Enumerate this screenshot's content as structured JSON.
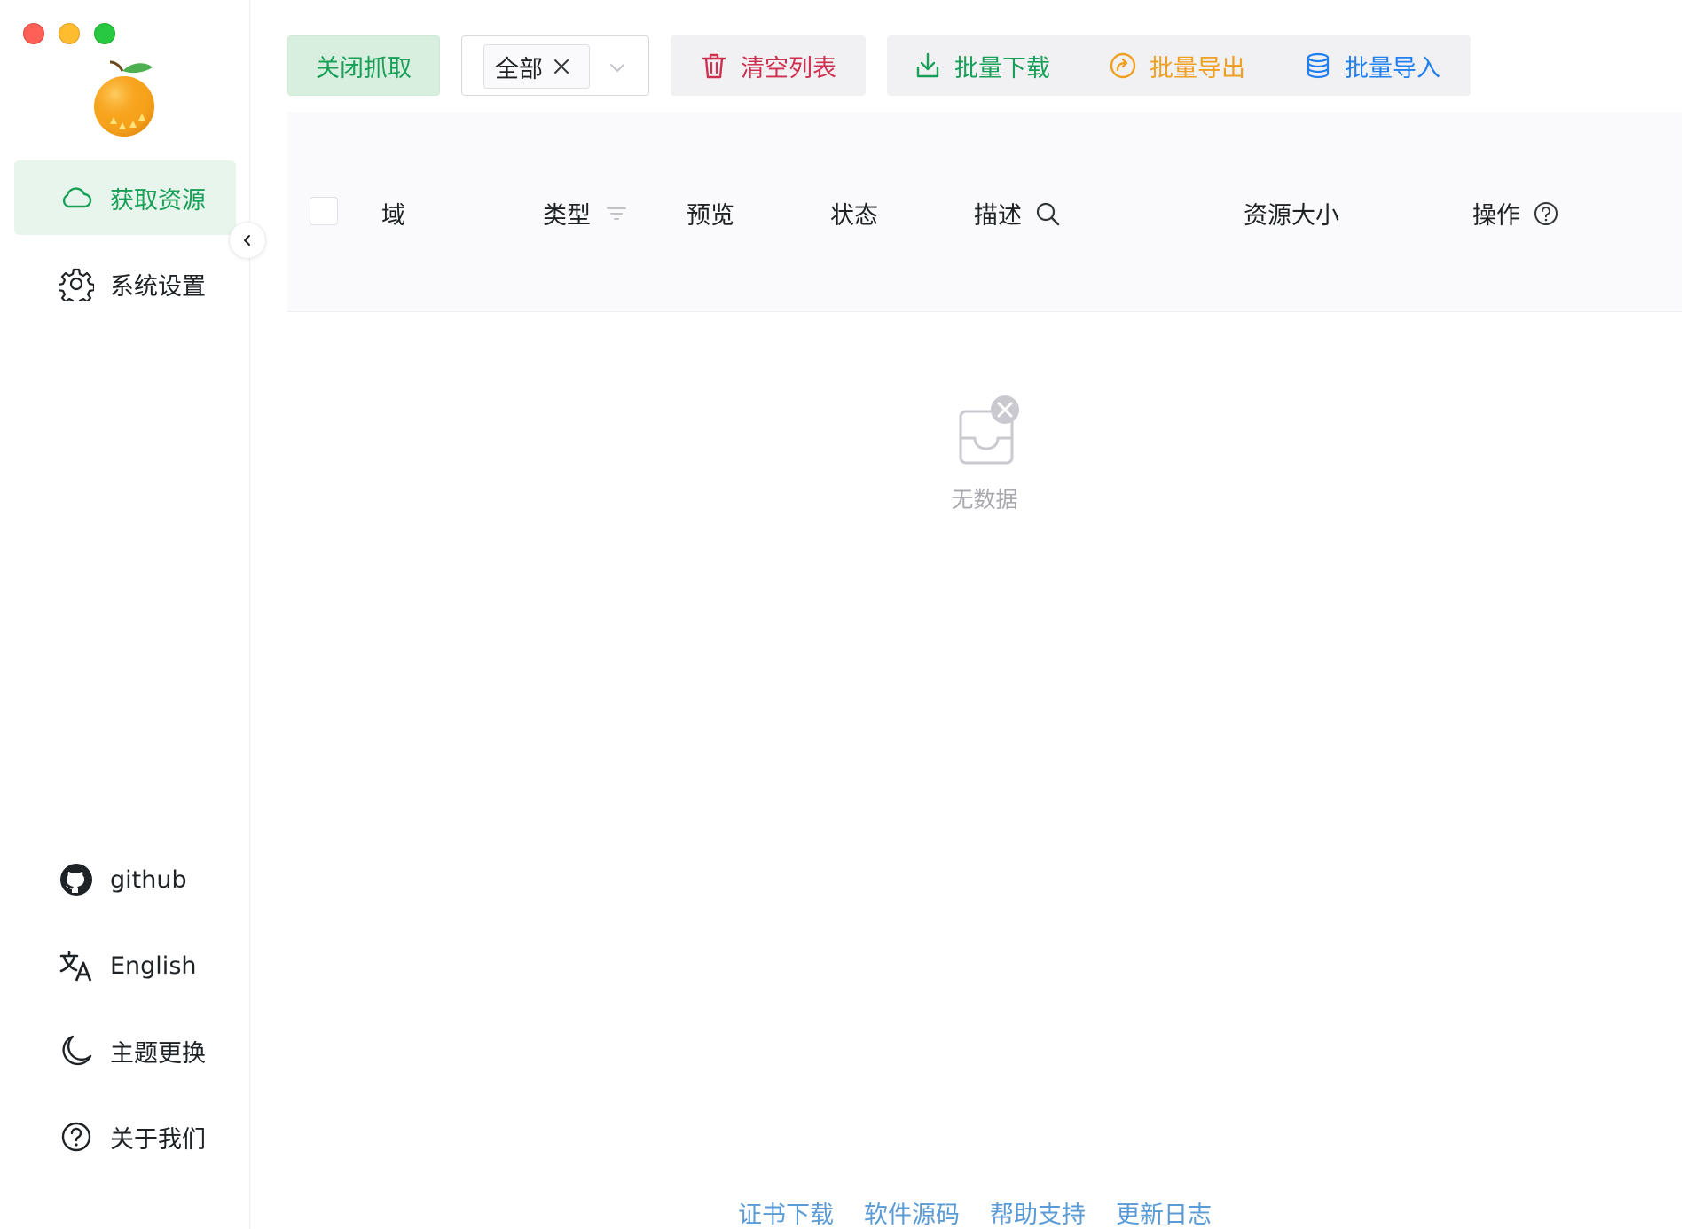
{
  "sidebar": {
    "logo": "orange-logo",
    "items": [
      {
        "label": "获取资源",
        "icon": "cloud-icon",
        "active": true
      },
      {
        "label": "系统设置",
        "icon": "gear-icon",
        "active": false
      }
    ],
    "bottom_items": [
      {
        "label": "github",
        "icon": "github-icon"
      },
      {
        "label": "English",
        "icon": "translate-icon"
      },
      {
        "label": "主题更换",
        "icon": "moon-icon"
      },
      {
        "label": "关于我们",
        "icon": "question-circle-icon"
      }
    ]
  },
  "toolbar": {
    "capture_label": "关闭抓取",
    "filter": {
      "selected_tag": "全部"
    },
    "clear_label": "清空列表",
    "download_label": "批量下载",
    "export_label": "批量导出",
    "import_label": "批量导入"
  },
  "table": {
    "columns": [
      "域",
      "类型",
      "预览",
      "状态",
      "描述",
      "资源大小",
      "操作"
    ],
    "empty_text": "无数据"
  },
  "footer": {
    "links": [
      "证书下载",
      "软件源码",
      "帮助支持",
      "更新日志"
    ]
  },
  "colors": {
    "primary": "#18a058",
    "danger": "#d03050",
    "warning": "#f0a020",
    "info": "#2080f0",
    "link": "#5a9bd6"
  }
}
